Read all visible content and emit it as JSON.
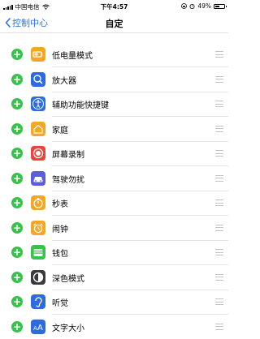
{
  "status": {
    "carrier": "中国电信",
    "time": "下午4:57",
    "battery": "49%",
    "battery_level": 0.49
  },
  "nav": {
    "back_label": "控制中心",
    "title": "自定"
  },
  "items": [
    {
      "label": "低电量模式",
      "icon": "battery-icon",
      "color": "#f5a623"
    },
    {
      "label": "放大器",
      "icon": "magnifier-icon",
      "color": "#2d6be0"
    },
    {
      "label": "辅助功能快捷键",
      "icon": "accessibility-icon",
      "color": "#2d6be0"
    },
    {
      "label": "家庭",
      "icon": "home-icon",
      "color": "#f5a623"
    },
    {
      "label": "屏幕录制",
      "icon": "screen-record-icon",
      "color": "#e8453c"
    },
    {
      "label": "驾驶勿扰",
      "icon": "car-icon",
      "color": "#5a5de0"
    },
    {
      "label": "秒表",
      "icon": "stopwatch-icon",
      "color": "#f5a623"
    },
    {
      "label": "闹钟",
      "icon": "alarm-icon",
      "color": "#f5a623"
    },
    {
      "label": "钱包",
      "icon": "wallet-icon",
      "color": "#3cc04d"
    },
    {
      "label": "深色模式",
      "icon": "dark-mode-icon",
      "color": "#3a3a3c"
    },
    {
      "label": "听觉",
      "icon": "ear-icon",
      "color": "#2d6be0"
    },
    {
      "label": "文字大小",
      "icon": "text-size-icon",
      "color": "#2d6be0"
    }
  ]
}
